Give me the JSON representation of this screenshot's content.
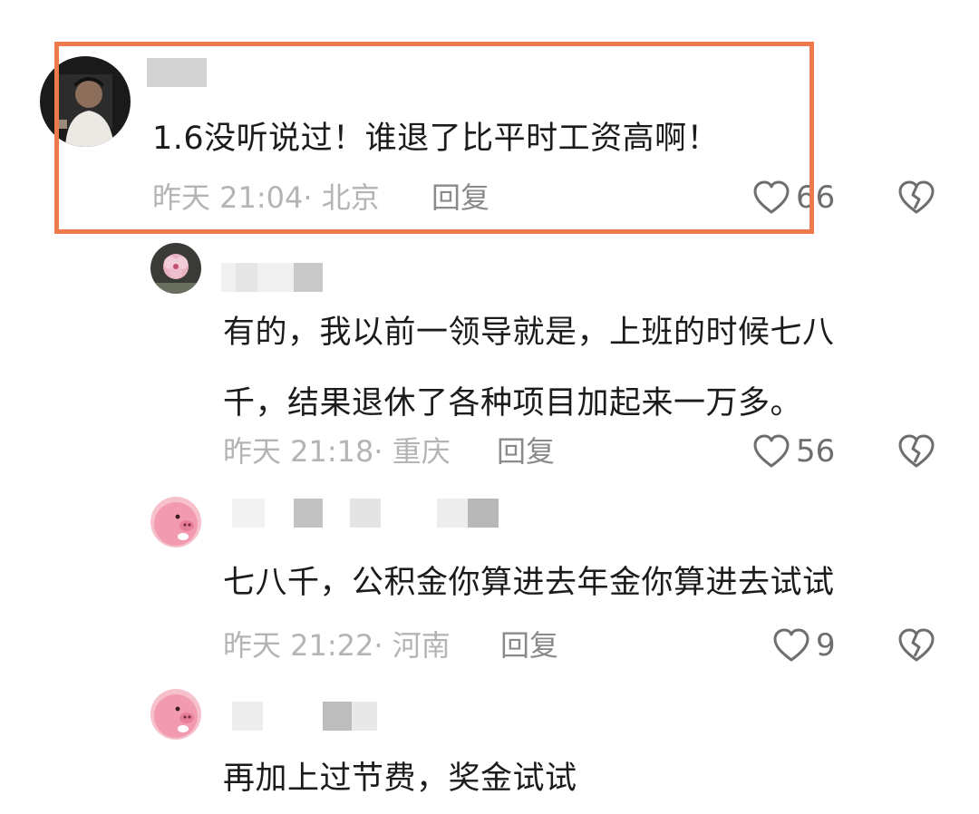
{
  "comments": [
    {
      "text_lines": [
        "1.6没听说过！谁退了比平时工资高啊！"
      ],
      "time": "昨天 21:04",
      "location": "北京",
      "reply_label": "回复",
      "likes": "66",
      "avatar_icon": "user-photo-avatar"
    },
    {
      "text_lines": [
        "有的，我以前一领导就是，上班的时候七八",
        "千，结果退休了各种项目加起来一万多。"
      ],
      "time": "昨天 21:18",
      "location": "重庆",
      "reply_label": "回复",
      "likes": "56",
      "avatar_icon": "flower-avatar"
    },
    {
      "text_lines": [
        "七八千，公积金你算进去年金你算进去试试"
      ],
      "time": "昨天 21:22",
      "location": "河南",
      "reply_label": "回复",
      "likes": "9",
      "avatar_icon": "pink-pig-avatar"
    },
    {
      "text_lines": [
        "再加上过节费，奖金试试"
      ],
      "avatar_icon": "pink-pig-avatar"
    }
  ],
  "colors": {
    "highlight": "#ec7a4b",
    "meta_text": "#b4b4b4",
    "reply_text": "#8a8a8a"
  }
}
